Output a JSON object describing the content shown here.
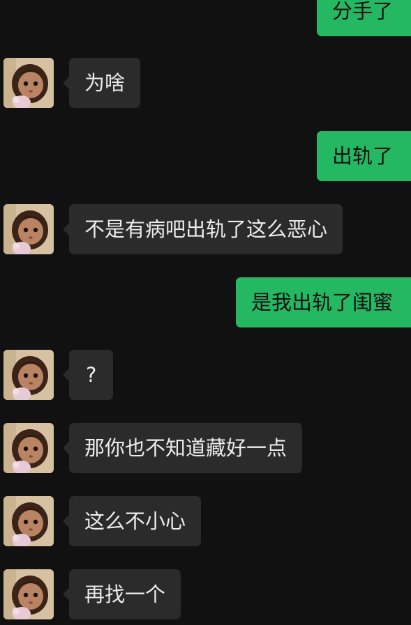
{
  "chat": {
    "messages": [
      {
        "side": "out",
        "text": "分手了"
      },
      {
        "side": "in",
        "text": "为啥"
      },
      {
        "side": "out",
        "text": "出轨了"
      },
      {
        "side": "in",
        "text": "不是有病吧出轨了这么恶心"
      },
      {
        "side": "out",
        "text": "是我出轨了闺蜜"
      },
      {
        "side": "in",
        "text": "?"
      },
      {
        "side": "in",
        "text": "那你也不知道藏好一点"
      },
      {
        "side": "in",
        "text": "这么不小心"
      },
      {
        "side": "in",
        "text": "再找一个"
      }
    ]
  },
  "colors": {
    "background": "#111111",
    "incoming_bubble": "#2b2b2b",
    "outgoing_bubble": "#25b862",
    "incoming_text": "#ececec",
    "outgoing_text": "#111111"
  },
  "icons": {
    "avatar": "girl-doll-avatar"
  }
}
